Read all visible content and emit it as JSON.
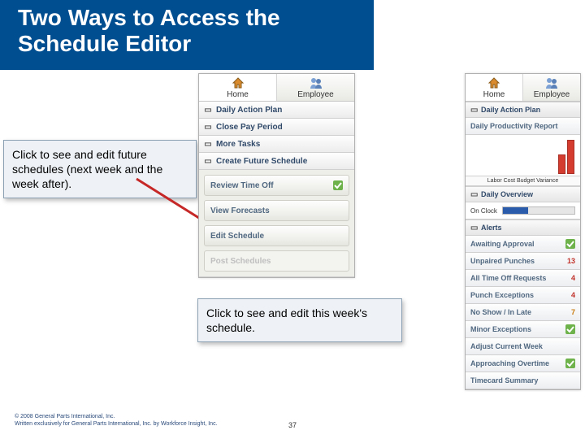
{
  "title_line1": "Two Ways to Access the",
  "title_line2": "Schedule Editor",
  "callout_left": "Click to see and edit future schedules (next week and the week after).",
  "callout_mid": "Click to see and edit this week's schedule.",
  "center": {
    "tab_home": "Home",
    "tab_employee": "Employee",
    "daily_action_plan": "Daily Action Plan",
    "close_pay_period": "Close Pay Period",
    "more_tasks": "More Tasks",
    "create_future_schedule": "Create Future Schedule",
    "review_time_off": "Review Time Off",
    "view_forecasts": "View Forecasts",
    "edit_schedule": "Edit Schedule",
    "post_schedules": "Post Schedules"
  },
  "right": {
    "tab_home": "Home",
    "tab_employee": "Employee",
    "daily_action_plan": "Daily Action Plan",
    "daily_prod_report": "Daily Productivity Report",
    "chart_caption": "Labor Cost Budget Variance",
    "daily_overview": "Daily Overview",
    "on_clock_label": "On Clock",
    "alerts": "Alerts",
    "awaiting_approval": "Awaiting Approval",
    "unpaired_punches": "Unpaired Punches",
    "unpaired_punches_val": "13",
    "time_off": "All Time Off Requests",
    "time_off_val": "4",
    "punch_exceptions": "Punch Exceptions",
    "punch_exceptions_val": "4",
    "no_show": "No Show / In Late",
    "no_show_val": "7",
    "minor_exceptions": "Minor Exceptions",
    "adjust_week": "Adjust Current Week",
    "approaching_ot": "Approaching Overtime",
    "timecard_summary": "Timecard Summary"
  },
  "footer_line1": "© 2008 General Parts International, Inc.",
  "footer_line2": "Written exclusively for General Parts International, Inc. by Workforce Insight, Inc.",
  "page_number": "37"
}
